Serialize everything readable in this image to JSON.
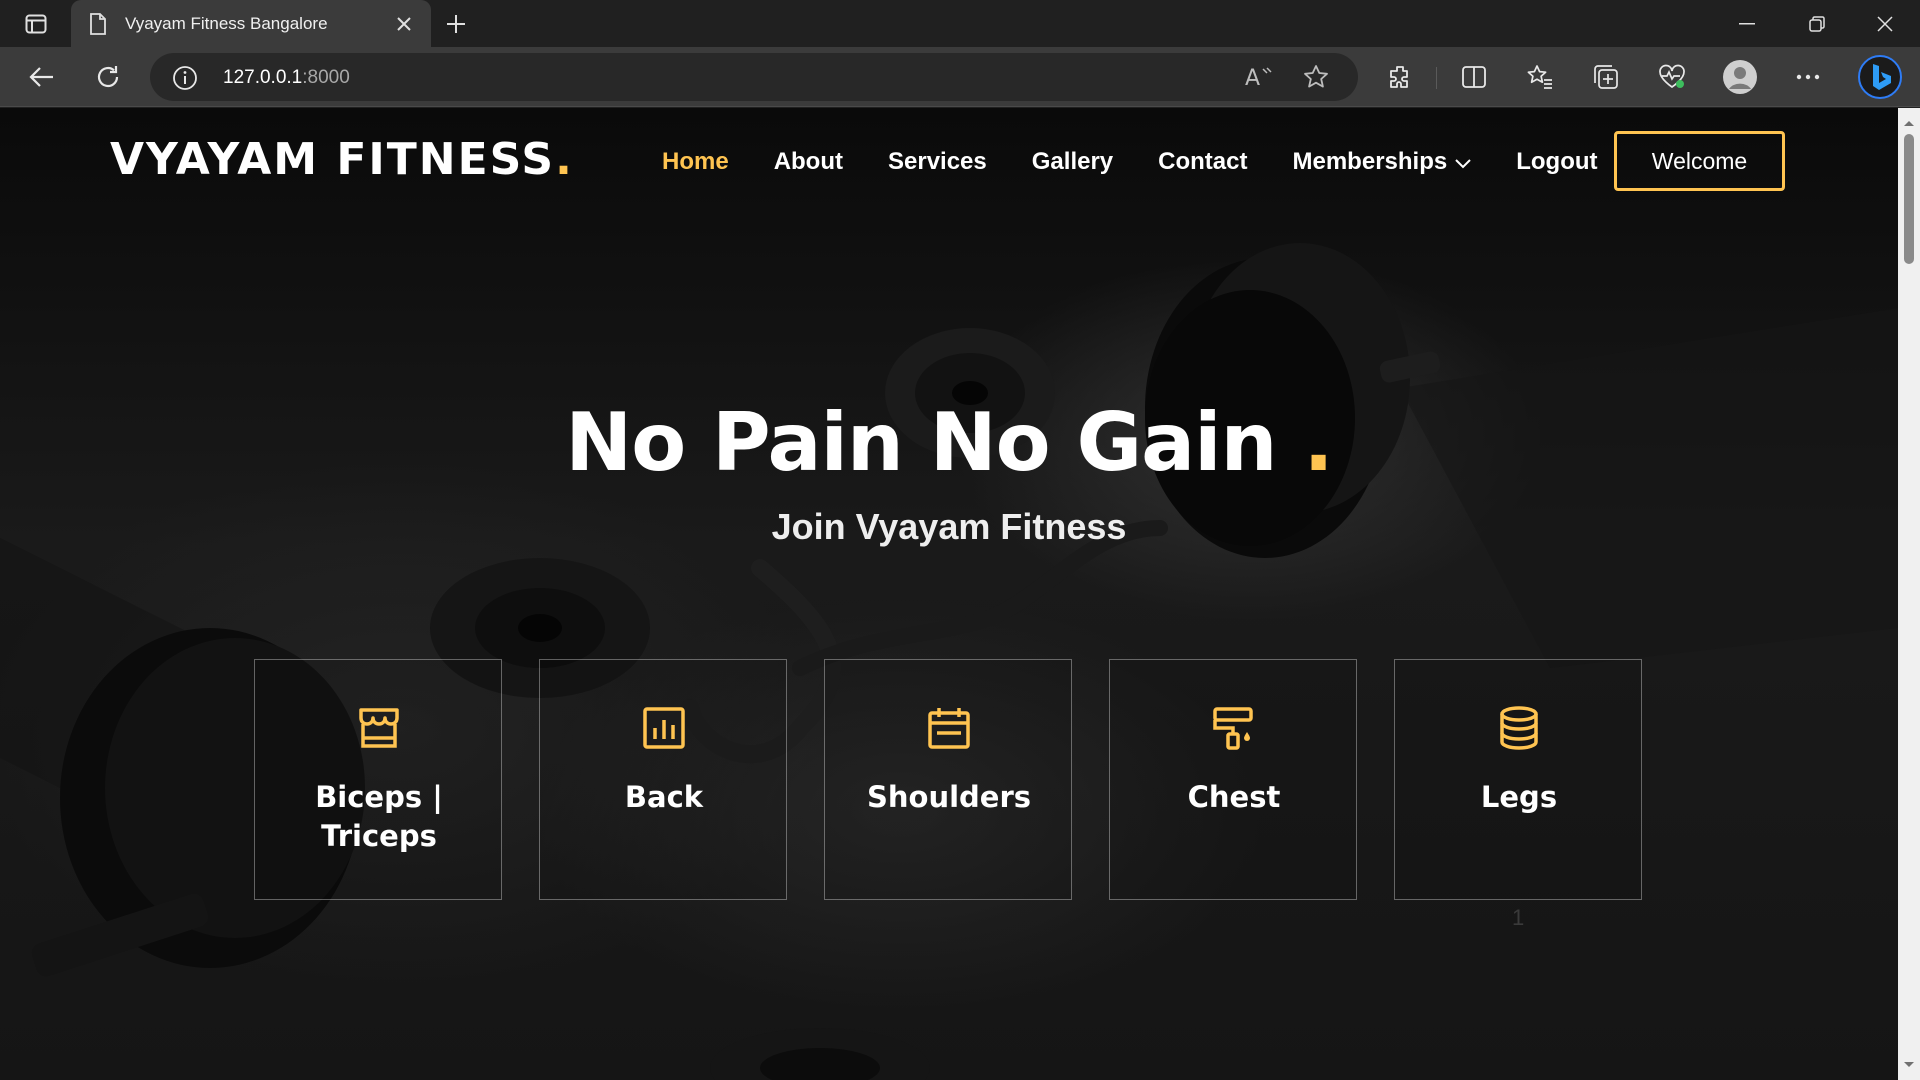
{
  "browser": {
    "tab_title": "Vyayam Fitness Bangalore",
    "url_host": "127.0.0.1",
    "url_port": ":8000"
  },
  "site": {
    "logo_text": "VYAYAM FITNESS",
    "logo_dot": ".",
    "nav": {
      "home": "Home",
      "about": "About",
      "services": "Services",
      "gallery": "Gallery",
      "contact": "Contact",
      "memberships": "Memberships",
      "logout": "Logout"
    },
    "welcome_button": "Welcome"
  },
  "hero": {
    "title": "No Pain No Gain",
    "title_dot": ".",
    "subtitle": "Join Vyayam Fitness"
  },
  "cards": [
    {
      "title": "Biceps | Triceps",
      "icon": "store-icon"
    },
    {
      "title": "Back",
      "icon": "bar-chart-icon"
    },
    {
      "title": "Shoulders",
      "icon": "calendar-icon"
    },
    {
      "title": "Chest",
      "icon": "paint-roller-icon"
    },
    {
      "title": "Legs",
      "icon": "database-icon"
    }
  ],
  "page_marker": "1",
  "colors": {
    "accent": "#ffc451",
    "background": "#0d0d0d",
    "chrome_dark": "#202020",
    "chrome_toolbar": "#3b3b3b"
  }
}
